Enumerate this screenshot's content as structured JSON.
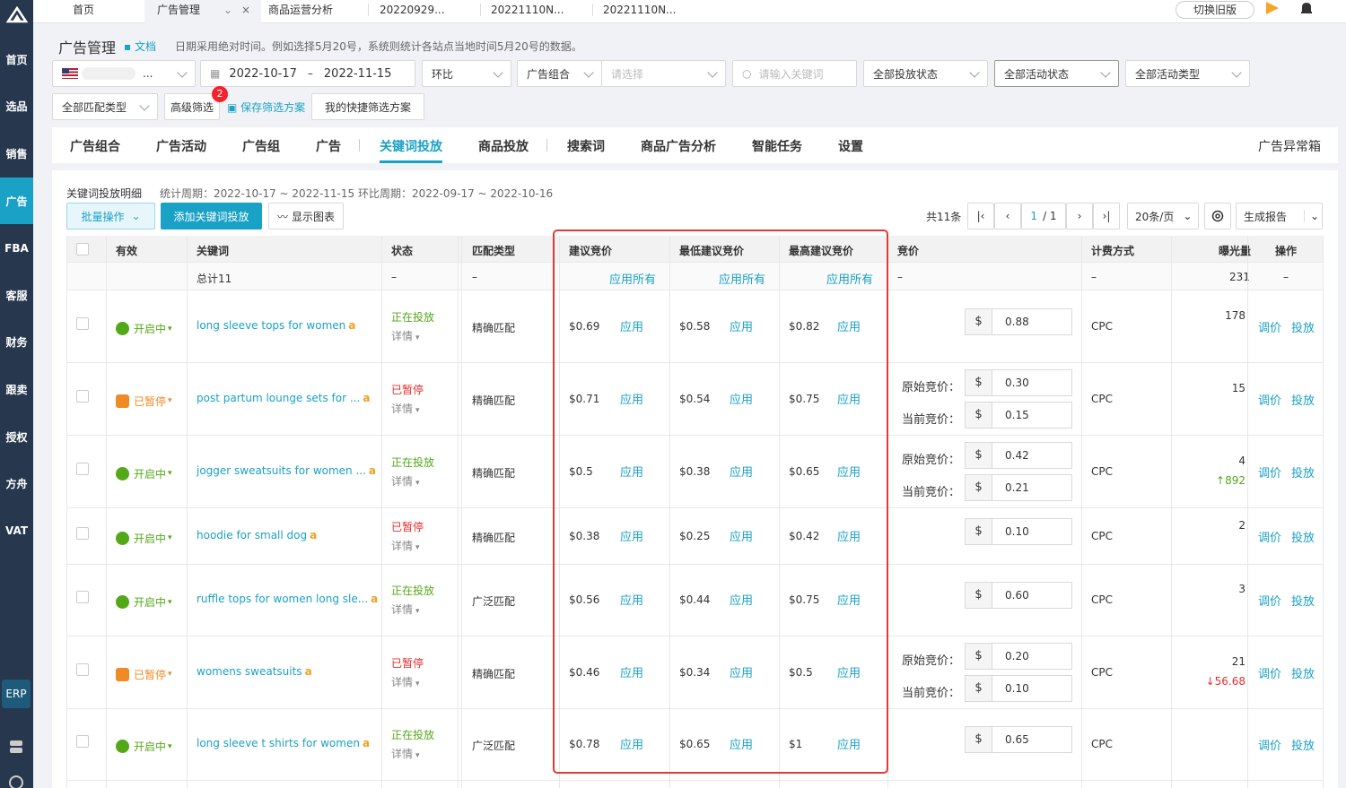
{
  "sidebar": {
    "items": [
      "首页",
      "选品",
      "销售",
      "广告",
      "FBA",
      "客服",
      "财务",
      "跟卖",
      "授权",
      "方舟",
      "VAT"
    ],
    "erp": "ERP"
  },
  "topbar": {
    "tabs": [
      "首页",
      "广告管理",
      "商品运营分析",
      "20220929...",
      "20221110N...",
      "20221110N..."
    ],
    "switch_label": "切换旧版"
  },
  "header": {
    "title": "广告管理",
    "doc_link": "文档",
    "hint": "日期采用绝对时间。例如选择5月20号，系统则统计各站点当地时间5月20号的数据。"
  },
  "filters": {
    "store_suffix": "...",
    "date_start": "2022-10-17",
    "date_sep": "–",
    "date_end": "2022-11-15",
    "compare": "环比",
    "portfolio": "广告组合",
    "portfolio_placeholder": "请选择",
    "search_placeholder": "请输入关键词",
    "delivery_status": "全部投放状态",
    "activity_status": "全部活动状态",
    "activity_type": "全部活动类型",
    "match_type": "全部匹配类型",
    "advanced": "高级筛选",
    "advanced_badge": "2",
    "save_scheme": "保存筛选方案",
    "my_schemes": "我的快捷筛选方案"
  },
  "main_tabs": [
    "广告组合",
    "广告活动",
    "广告组",
    "广告",
    "关键词投放",
    "商品投放",
    "搜索词",
    "商品广告分析",
    "智能任务",
    "设置"
  ],
  "anomaly_box": "广告异常箱",
  "section": {
    "title": "关键词投放明细",
    "period": "统计周期：2022-10-17 ~ 2022-11-15 环比周期：2022-09-17 ~ 2022-10-16",
    "batch": "批量操作",
    "add": "添加关键词投放",
    "chart": "显示图表",
    "total": "共11条",
    "page_current": "1",
    "page_total": "/ 1",
    "page_size": "20条/页",
    "report": "生成报告"
  },
  "table": {
    "headers": [
      "有效",
      "关键词",
      "状态",
      "匹配类型",
      "建议竞价",
      "最低建议竞价",
      "最高建议竞价",
      "竞价",
      "计费方式",
      "曝光量",
      "操作"
    ],
    "summary": {
      "keyword": "总计11",
      "status": "–",
      "match": "–",
      "apply_all": "应用所有",
      "bid": "–",
      "billing": "–",
      "impr": "231",
      "op": "–"
    },
    "apply": "应用",
    "detail": "详情",
    "orig_label": "原始竞价：",
    "curr_label": "当前竞价：",
    "currency": "$",
    "op_adjust": "调价",
    "op_deliver": "投放",
    "rows": [
      {
        "valid": "开启中",
        "keyword": "long sleeve tops for women",
        "status": "正在投放",
        "match": "精确匹配",
        "sugg": "$0.69",
        "low": "$0.58",
        "high": "$0.82",
        "bid": "0.88",
        "billing": "CPC",
        "impr": "178",
        "delta": ""
      },
      {
        "valid": "已暂停",
        "keyword": "post partum lounge sets for ...",
        "status": "已暂停",
        "match": "精确匹配",
        "sugg": "$0.71",
        "low": "$0.54",
        "high": "$0.75",
        "orig": "0.30",
        "curr": "0.15",
        "billing": "CPC",
        "impr": "15",
        "delta": ""
      },
      {
        "valid": "开启中",
        "keyword": "jogger sweatsuits for women ...",
        "status": "正在投放",
        "match": "精确匹配",
        "sugg": "$0.5",
        "low": "$0.38",
        "high": "$0.65",
        "orig": "0.42",
        "curr": "0.21",
        "billing": "CPC",
        "impr": "4",
        "delta": "↑892"
      },
      {
        "valid": "开启中",
        "keyword": "hoodie for small dog",
        "status": "已暂停",
        "match": "精确匹配",
        "sugg": "$0.38",
        "low": "$0.25",
        "high": "$0.42",
        "bid": "0.10",
        "billing": "CPC",
        "impr": "2",
        "delta": ""
      },
      {
        "valid": "开启中",
        "keyword": "ruffle tops for women long sle...",
        "status": "正在投放",
        "match": "广泛匹配",
        "sugg": "$0.56",
        "low": "$0.44",
        "high": "$0.75",
        "bid": "0.60",
        "billing": "CPC",
        "impr": "3",
        "delta": ""
      },
      {
        "valid": "已暂停",
        "keyword": "womens sweatsuits",
        "status": "已暂停",
        "match": "精确匹配",
        "sugg": "$0.46",
        "low": "$0.34",
        "high": "$0.5",
        "orig": "0.20",
        "curr": "0.10",
        "billing": "CPC",
        "impr": "21",
        "delta": "↓56.68"
      },
      {
        "valid": "开启中",
        "keyword": "long sleeve t shirts for women",
        "status": "正在投放",
        "match": "广泛匹配",
        "sugg": "$0.78",
        "low": "$0.65",
        "high": "$1",
        "bid": "0.65",
        "billing": "CPC",
        "impr": "",
        "delta": ""
      }
    ]
  },
  "colors": {
    "accent": "#1aa1c6",
    "sidebar": "#26374e",
    "on": "#52a818",
    "off": "#e62e2e",
    "paused": "#f08a24",
    "highlight": "#e53935"
  }
}
